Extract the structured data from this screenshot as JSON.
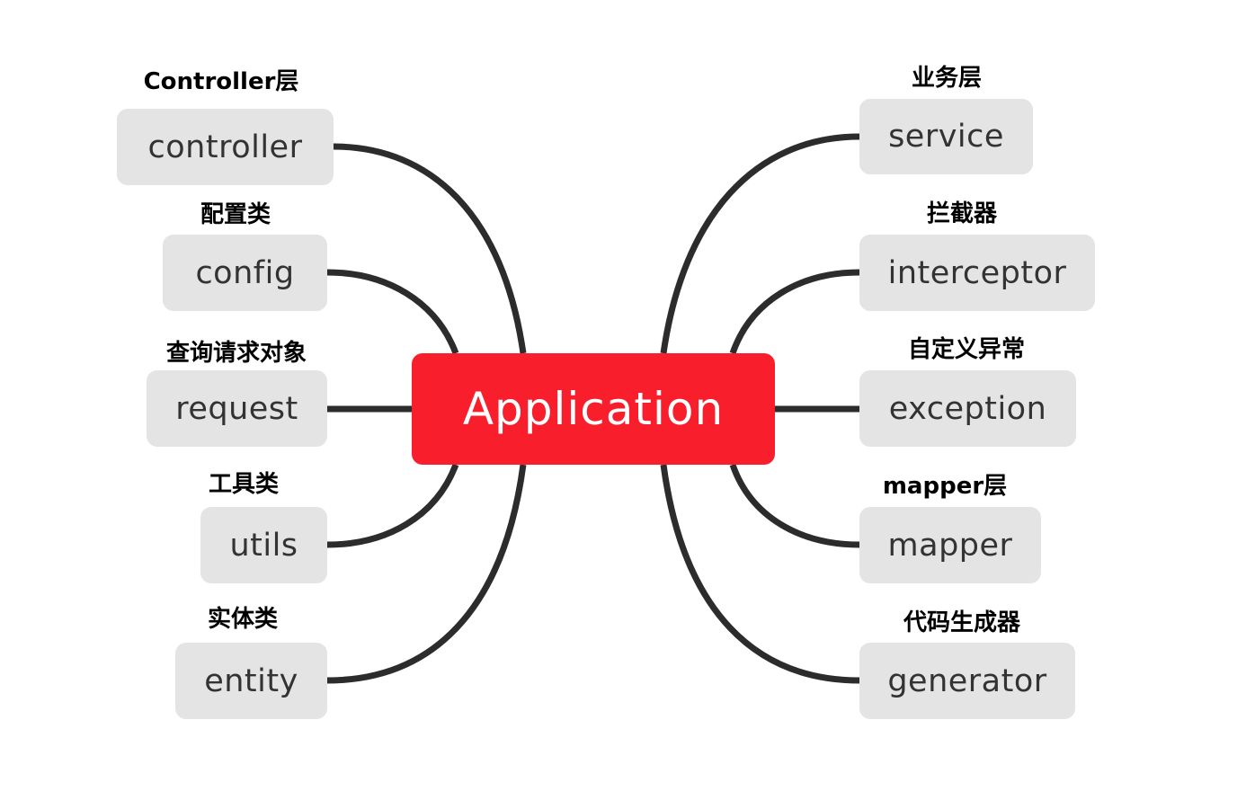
{
  "diagram": {
    "type": "mind-map",
    "root": {
      "label": "Application",
      "color": "#f91e2c"
    },
    "edge_color": "#2c2c2c",
    "node_color": "#e4e4e4",
    "left_branches": [
      {
        "id": "controller",
        "label": "controller",
        "caption": "Controller层"
      },
      {
        "id": "config",
        "label": "config",
        "caption": "配置类"
      },
      {
        "id": "request",
        "label": "request",
        "caption": "查询请求对象"
      },
      {
        "id": "utils",
        "label": "utils",
        "caption": "工具类"
      },
      {
        "id": "entity",
        "label": "entity",
        "caption": "实体类"
      }
    ],
    "right_branches": [
      {
        "id": "service",
        "label": "service",
        "caption": "业务层"
      },
      {
        "id": "interceptor",
        "label": "interceptor",
        "caption": "拦截器"
      },
      {
        "id": "exception",
        "label": "exception",
        "caption": "自定义异常"
      },
      {
        "id": "mapper",
        "label": "mapper",
        "caption": "mapper层"
      },
      {
        "id": "generator",
        "label": "generator",
        "caption": "代码生成器"
      }
    ]
  }
}
